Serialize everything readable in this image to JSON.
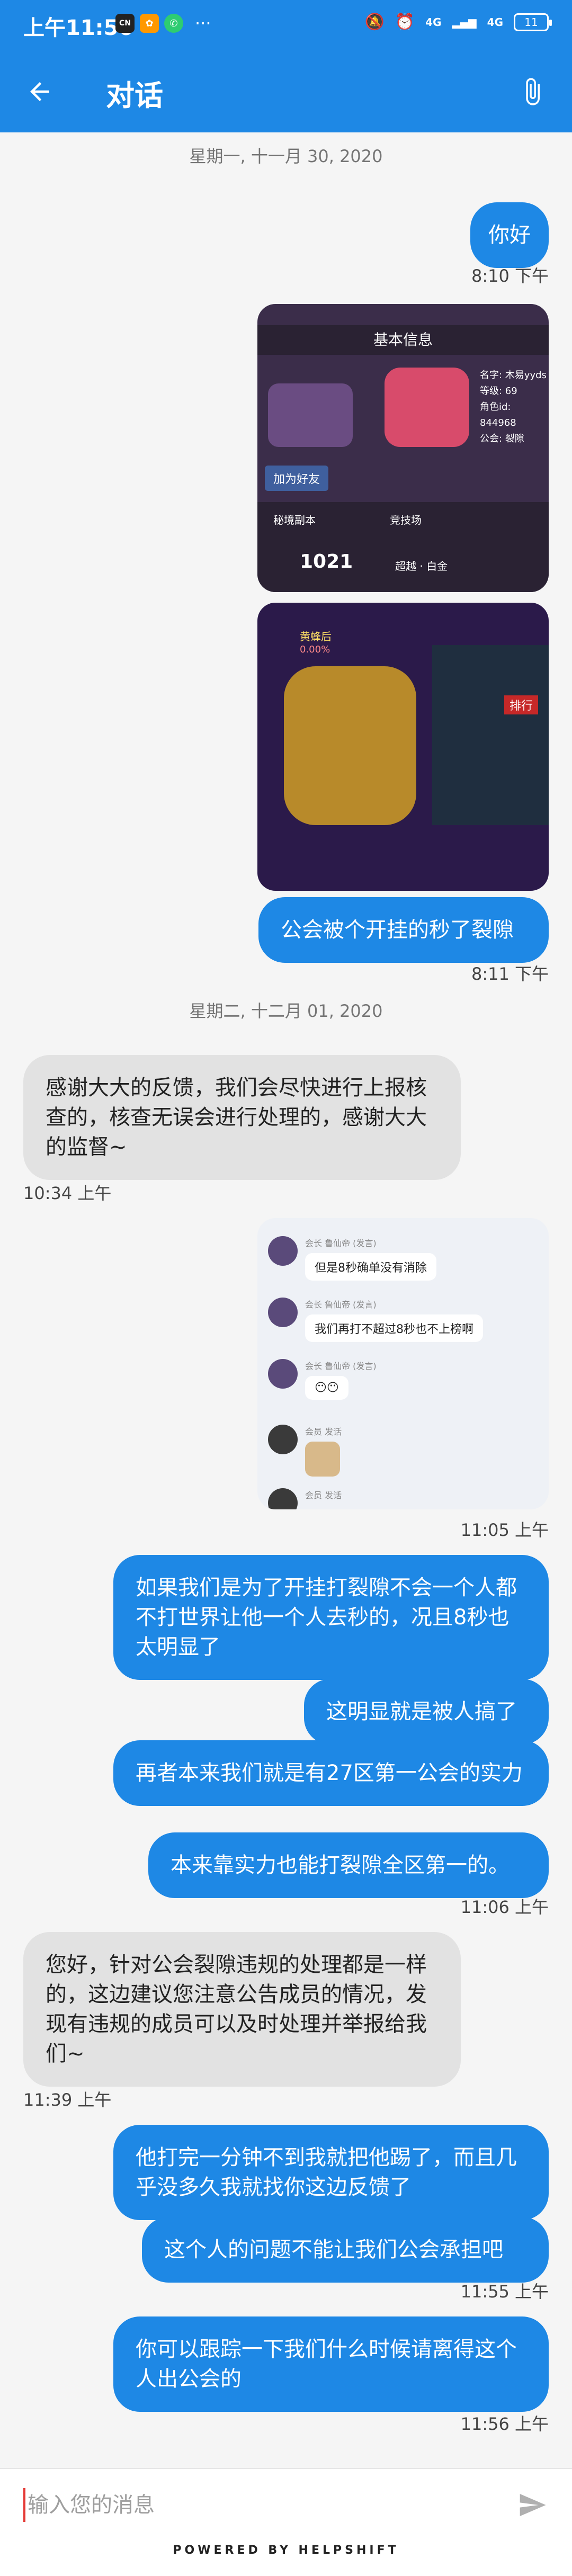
{
  "status_bar": {
    "time": "上午11:56",
    "app_icons": [
      "cn-icon",
      "orange-app-icon",
      "phone-app-icon"
    ],
    "more": "···",
    "network_1": "4G",
    "network_2": "4G",
    "battery": "11"
  },
  "app_bar": {
    "title": "对话"
  },
  "messages": {
    "date1": "星期一, 十一月 30, 2020",
    "m1_text": "你好",
    "m1_time": "8:10 下午",
    "img1": {
      "title": "基本信息",
      "info_name": "名字: 木易yyds",
      "info_level": "等级: 69",
      "info_id": "角色id: 844968",
      "info_guild": "公会: 裂隙",
      "add_friend": "加为好友",
      "stat1_label": "秘境副本",
      "stat1_value": "1021",
      "stat2_label": "竞技场",
      "stat2_value": "超越 · 白金"
    },
    "img2": {
      "boss_name": "黄蜂后",
      "percent": "0.00%",
      "rank_label": "排行"
    },
    "m2_text": "公会被个开挂的秒了裂隙",
    "m2_time": "8:11 下午",
    "date2": "星期二, 十二月 01, 2020",
    "m3_text": "感谢大大的反馈，我们会尽快进行上报核查的，核查无误会进行处理的，感谢大大的监督~",
    "m3_time": "10:34 上午",
    "img3": {
      "r1_name": "会长 鲁仙帝 (发言)",
      "r1_msg": "但是8秒确单没有消除",
      "r2_name": "会长 鲁仙帝 (发言)",
      "r2_msg": "我们再打不超过8秒也不上榜啊",
      "r3_name": "会长 鲁仙帝 (发言)",
      "r3_msg": "😶😶",
      "r4_name": "会员 发话",
      "r5_name": "会员 发话"
    },
    "img3_time": "11:05 上午",
    "m4_text": "如果我们是为了开挂打裂隙不会一个人都不打世界让他一个人去秒的，况且8秒也太明显了",
    "m5_text": "这明显就是被人搞了",
    "m6_text": "再者本来我们就是有27区第一公会的实力",
    "m7_text": "本来靠实力也能打裂隙全区第一的。",
    "m7_time": "11:06 上午",
    "m8_text": "您好，针对公会裂隙违规的处理都是一样的，这边建议您注意公告成员的情况，发现有违规的成员可以及时处理并举报给我们~",
    "m8_time": "11:39 上午",
    "m9_text": "他打完一分钟不到我就把他踢了，而且几乎没多久我就找你这边反馈了",
    "m10_text": "这个人的问题不能让我们公会承担吧",
    "m10_time": "11:55 上午",
    "m11_text": "你可以跟踪一下我们什么时候请离得这个人出公会的",
    "m11_time": "11:56 上午"
  },
  "input": {
    "placeholder": "输入您的消息"
  },
  "footer": {
    "powered": "POWERED BY HELPSHIFT"
  },
  "colors": {
    "primary": "#1e88e5",
    "incoming_bubble": "#e2e2e2",
    "background": "#f5f5f5"
  }
}
